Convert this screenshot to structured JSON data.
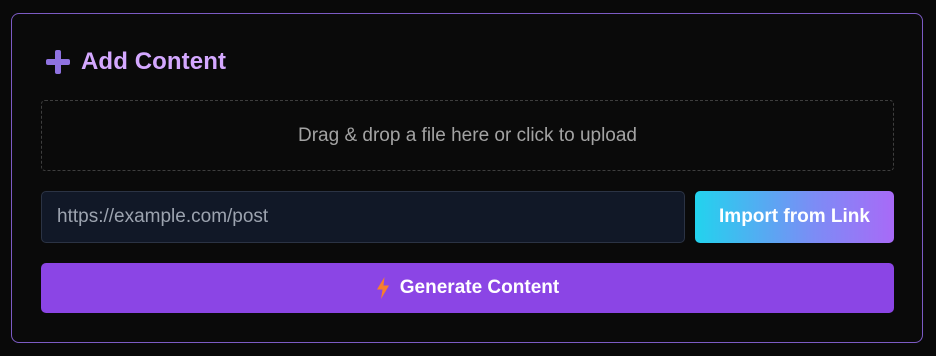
{
  "panel": {
    "title": "Add Content",
    "title_icon": "plus-icon",
    "accent_color": "#d4a8ff"
  },
  "dropzone": {
    "text": "Drag & drop a file here or click to upload"
  },
  "link_import": {
    "input_value": "",
    "input_placeholder": "https://example.com/post",
    "button_label": "Import from Link"
  },
  "generate": {
    "button_label": "Generate Content",
    "icon": "lightning-bolt-icon",
    "button_color": "#8b45e5"
  }
}
